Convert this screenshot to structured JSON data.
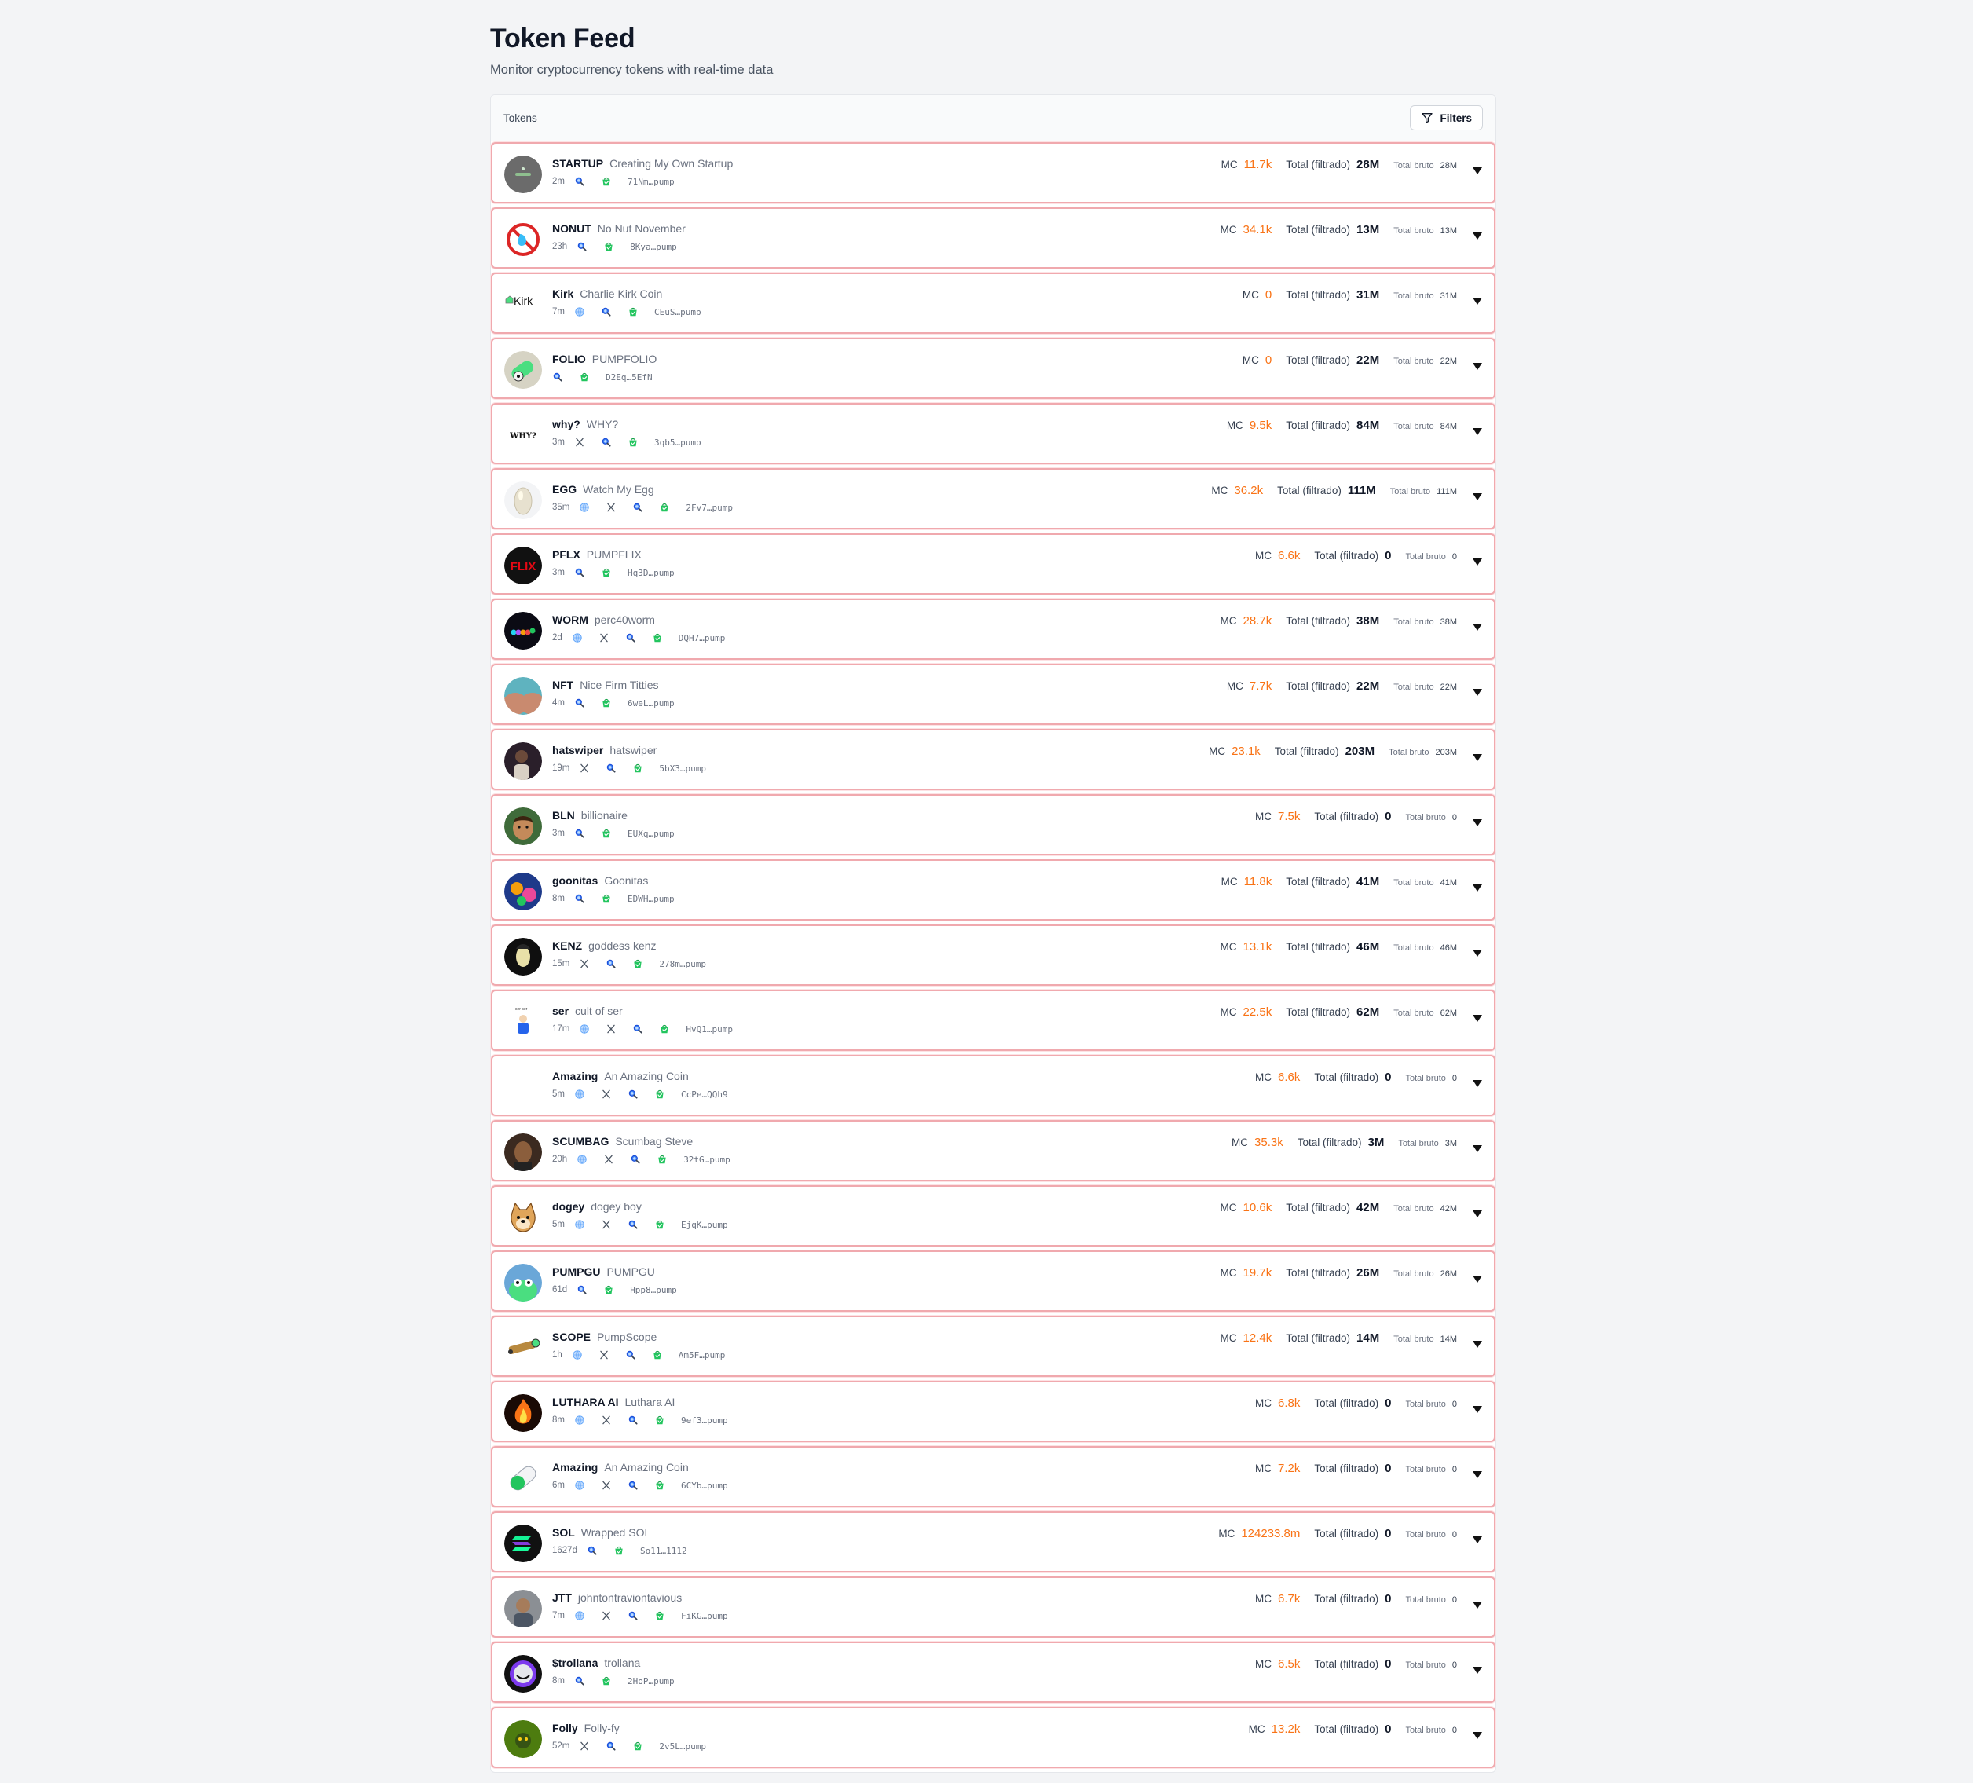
{
  "page": {
    "title": "Token Feed",
    "subtitle": "Monitor cryptocurrency tokens with real-time data"
  },
  "panel": {
    "label": "Tokens",
    "filters_label": "Filters"
  },
  "labels": {
    "mc": "MC",
    "total_filtrado": "Total (filtrado)",
    "total_bruto": "Total bruto"
  },
  "colors": {
    "row_border": "#f0a9ae",
    "mc_value": "#f97316",
    "search_icon": "#2563eb",
    "bag_icon": "#22c55e",
    "web_icon": "#60a5fa"
  },
  "tokens": [
    {
      "symbol": "STARTUP",
      "name": "Creating My Own Startup",
      "age": "2m",
      "links": [
        "search",
        "bag"
      ],
      "address": "71Nm…pump",
      "mc": "11.7k",
      "total_filtrado": "28M",
      "total_bruto": "28M",
      "avatar": "grey-logo"
    },
    {
      "symbol": "NONUT",
      "name": "No Nut November",
      "age": "23h",
      "links": [
        "search",
        "bag"
      ],
      "address": "8Kya…pump",
      "mc": "34.1k",
      "total_filtrado": "13M",
      "total_bruto": "13M",
      "avatar": "no-sign"
    },
    {
      "symbol": "Kirk",
      "name": "Charlie Kirk Coin",
      "age": "7m",
      "links": [
        "web",
        "search",
        "bag"
      ],
      "address": "CEuS…pump",
      "mc": "0",
      "total_filtrado": "31M",
      "total_bruto": "31M",
      "avatar": "broken-image",
      "avatar_text": "Kirk"
    },
    {
      "symbol": "FOLIO",
      "name": "PUMPFOLIO",
      "age": "",
      "links": [
        "search",
        "bag"
      ],
      "address": "D2Eq…5EfN",
      "mc": "0",
      "total_filtrado": "22M",
      "total_bruto": "22M",
      "avatar": "pill-face"
    },
    {
      "symbol": "why?",
      "name": "WHY?",
      "age": "3m",
      "links": [
        "x",
        "search",
        "bag"
      ],
      "address": "3qb5…pump",
      "mc": "9.5k",
      "total_filtrado": "84M",
      "total_bruto": "84M",
      "avatar": "text-why",
      "avatar_text": "WHY?"
    },
    {
      "symbol": "EGG",
      "name": "Watch My Egg",
      "age": "35m",
      "links": [
        "web",
        "x",
        "search",
        "bag"
      ],
      "address": "2Fv7…pump",
      "mc": "36.2k",
      "total_filtrado": "111M",
      "total_bruto": "111M",
      "avatar": "egg"
    },
    {
      "symbol": "PFLX",
      "name": "PUMPFLIX",
      "age": "3m",
      "links": [
        "search",
        "bag"
      ],
      "address": "Hq3D…pump",
      "mc": "6.6k",
      "total_filtrado": "0",
      "total_bruto": "0",
      "avatar": "flix",
      "avatar_text": "FLIX"
    },
    {
      "symbol": "WORM",
      "name": "perc40worm",
      "age": "2d",
      "links": [
        "web",
        "x",
        "search",
        "bag"
      ],
      "address": "DQH7…pump",
      "mc": "28.7k",
      "total_filtrado": "38M",
      "total_bruto": "38M",
      "avatar": "worm"
    },
    {
      "symbol": "NFT",
      "name": "Nice Firm Titties",
      "age": "4m",
      "links": [
        "search",
        "bag"
      ],
      "address": "6weL…pump",
      "mc": "7.7k",
      "total_filtrado": "22M",
      "total_bruto": "22M",
      "avatar": "skin"
    },
    {
      "symbol": "hatswiper",
      "name": "hatswiper",
      "age": "19m",
      "links": [
        "x",
        "search",
        "bag"
      ],
      "address": "5bX3…pump",
      "mc": "23.1k",
      "total_filtrado": "203M",
      "total_bruto": "203M",
      "avatar": "dark-photo"
    },
    {
      "symbol": "BLN",
      "name": "billionaire",
      "age": "3m",
      "links": [
        "search",
        "bag"
      ],
      "address": "EUXq…pump",
      "mc": "7.5k",
      "total_filtrado": "0",
      "total_bruto": "0",
      "avatar": "face-green"
    },
    {
      "symbol": "goonitas",
      "name": "Goonitas",
      "age": "8m",
      "links": [
        "search",
        "bag"
      ],
      "address": "EDWH…pump",
      "mc": "11.8k",
      "total_filtrado": "41M",
      "total_bruto": "41M",
      "avatar": "colorful"
    },
    {
      "symbol": "KENZ",
      "name": "goddess kenz",
      "age": "15m",
      "links": [
        "x",
        "search",
        "bag"
      ],
      "address": "278m…pump",
      "mc": "13.1k",
      "total_filtrado": "46M",
      "total_bruto": "46M",
      "avatar": "dark-face"
    },
    {
      "symbol": "ser",
      "name": "cult of ser",
      "age": "17m",
      "links": [
        "web",
        "x",
        "search",
        "bag"
      ],
      "address": "HvQ1…pump",
      "mc": "22.5k",
      "total_filtrado": "62M",
      "total_bruto": "62M",
      "avatar": "ser-figure"
    },
    {
      "symbol": "Amazing",
      "name": "An Amazing Coin",
      "age": "5m",
      "links": [
        "web",
        "x",
        "search",
        "bag"
      ],
      "address": "CcPe…QQh9",
      "mc": "6.6k",
      "total_filtrado": "0",
      "total_bruto": "0",
      "avatar": "blank"
    },
    {
      "symbol": "SCUMBAG",
      "name": "Scumbag Steve",
      "age": "20h",
      "links": [
        "web",
        "x",
        "search",
        "bag"
      ],
      "address": "32tG…pump",
      "mc": "35.3k",
      "total_filtrado": "3M",
      "total_bruto": "3M",
      "avatar": "brown-photo"
    },
    {
      "symbol": "dogey",
      "name": "dogey boy",
      "age": "5m",
      "links": [
        "web",
        "x",
        "search",
        "bag"
      ],
      "address": "EjqK…pump",
      "mc": "10.6k",
      "total_filtrado": "42M",
      "total_bruto": "42M",
      "avatar": "doge"
    },
    {
      "symbol": "PUMPGU",
      "name": "PUMPGU",
      "age": "61d",
      "links": [
        "search",
        "bag"
      ],
      "address": "Hpp8…pump",
      "mc": "19.7k",
      "total_filtrado": "26M",
      "total_bruto": "26M",
      "avatar": "green-frog"
    },
    {
      "symbol": "SCOPE",
      "name": "PumpScope",
      "age": "1h",
      "links": [
        "web",
        "x",
        "search",
        "bag"
      ],
      "address": "Am5F…pump",
      "mc": "12.4k",
      "total_filtrado": "14M",
      "total_bruto": "14M",
      "avatar": "telescope"
    },
    {
      "symbol": "LUTHARA AI",
      "name": "Luthara AI",
      "age": "8m",
      "links": [
        "web",
        "x",
        "search",
        "bag"
      ],
      "address": "9ef3…pump",
      "mc": "6.8k",
      "total_filtrado": "0",
      "total_bruto": "0",
      "avatar": "fire"
    },
    {
      "symbol": "Amazing",
      "name": "An Amazing Coin",
      "age": "6m",
      "links": [
        "web",
        "x",
        "search",
        "bag"
      ],
      "address": "6CYb…pump",
      "mc": "7.2k",
      "total_filtrado": "0",
      "total_bruto": "0",
      "avatar": "pill-green"
    },
    {
      "symbol": "SOL",
      "name": "Wrapped SOL",
      "age": "1627d",
      "links": [
        "search",
        "bag"
      ],
      "address": "So11…1112",
      "mc": "124233.8m",
      "total_filtrado": "0",
      "total_bruto": "0",
      "avatar": "solana"
    },
    {
      "symbol": "JTT",
      "name": "johntontraviontavious",
      "age": "7m",
      "links": [
        "web",
        "x",
        "search",
        "bag"
      ],
      "address": "FiKG…pump",
      "mc": "6.7k",
      "total_filtrado": "0",
      "total_bruto": "0",
      "avatar": "grey-photo"
    },
    {
      "symbol": "$trollana",
      "name": "trollana",
      "age": "8m",
      "links": [
        "search",
        "bag"
      ],
      "address": "2HoP…pump",
      "mc": "6.5k",
      "total_filtrado": "0",
      "total_bruto": "0",
      "avatar": "troll"
    },
    {
      "symbol": "Folly",
      "name": "Folly-fy",
      "age": "52m",
      "links": [
        "x",
        "search",
        "bag"
      ],
      "address": "2v5L…pump",
      "mc": "13.2k",
      "total_filtrado": "0",
      "total_bruto": "0",
      "avatar": "olive-frog"
    }
  ]
}
